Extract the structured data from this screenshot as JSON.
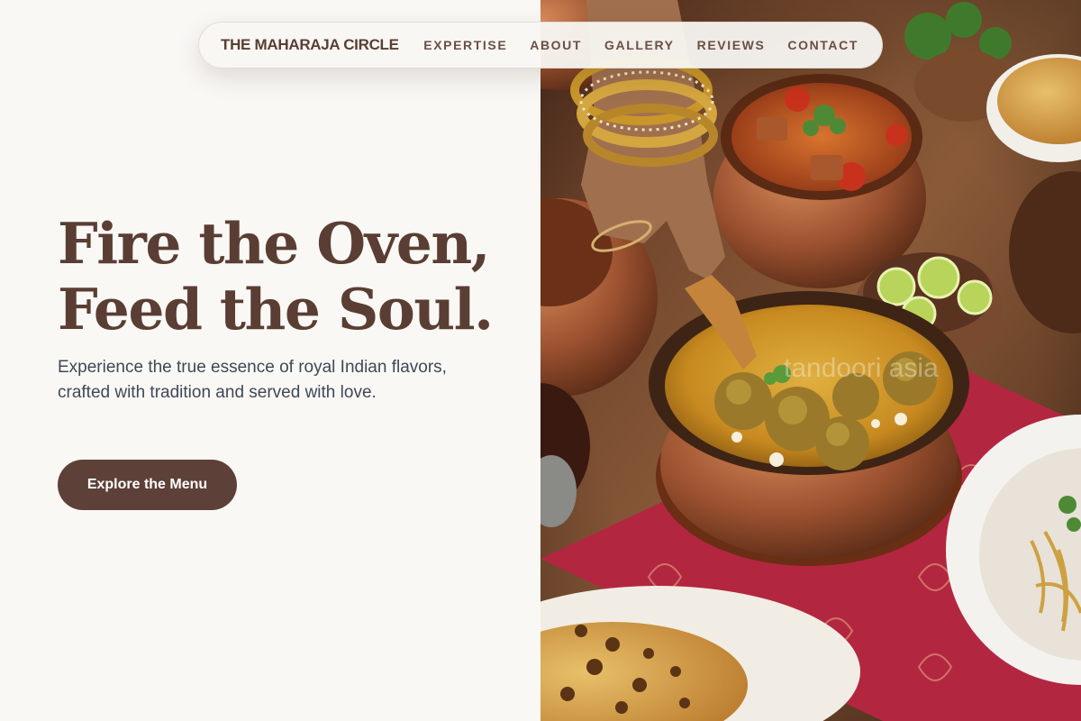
{
  "nav": {
    "brand": "THE MAHARAJA CIRCLE",
    "links": [
      "EXPERTISE",
      "ABOUT",
      "GALLERY",
      "REVIEWS",
      "CONTACT"
    ]
  },
  "hero": {
    "heading_line1": "Fire the Oven,",
    "heading_line2": "Feed the Soul.",
    "subtext": "Experience the true essence of royal Indian flavors, crafted with tradition and served with love.",
    "cta_label": "Explore the Menu",
    "watermark": "tandoori asia"
  },
  "colors": {
    "background": "#faf8f5",
    "heading": "#5a3e33",
    "body_text": "#3f4856",
    "button": "#5d4037",
    "button_text": "#ffffff"
  },
  "image": {
    "subject": "food-photo"
  }
}
